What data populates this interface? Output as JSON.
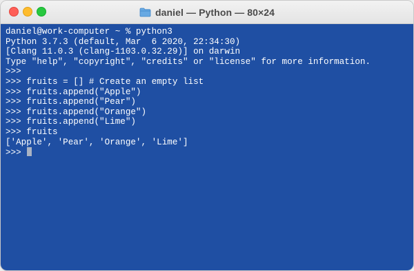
{
  "window": {
    "title": "daniel — Python — 80×24",
    "title_icon": "folder-icon"
  },
  "terminal": {
    "lines": [
      "daniel@work-computer ~ % python3",
      "Python 3.7.3 (default, Mar  6 2020, 22:34:30)",
      "[Clang 11.0.3 (clang-1103.0.32.29)] on darwin",
      "Type \"help\", \"copyright\", \"credits\" or \"license\" for more information.",
      ">>>",
      ">>> fruits = [] # Create an empty list",
      ">>> fruits.append(\"Apple\")",
      ">>> fruits.append(\"Pear\")",
      ">>> fruits.append(\"Orange\")",
      ">>> fruits.append(\"Lime\")",
      ">>> fruits",
      "['Apple', 'Pear', 'Orange', 'Lime']"
    ],
    "prompt": ">>> ",
    "background_color": "#1f4fa3",
    "text_color": "#ffffff"
  }
}
